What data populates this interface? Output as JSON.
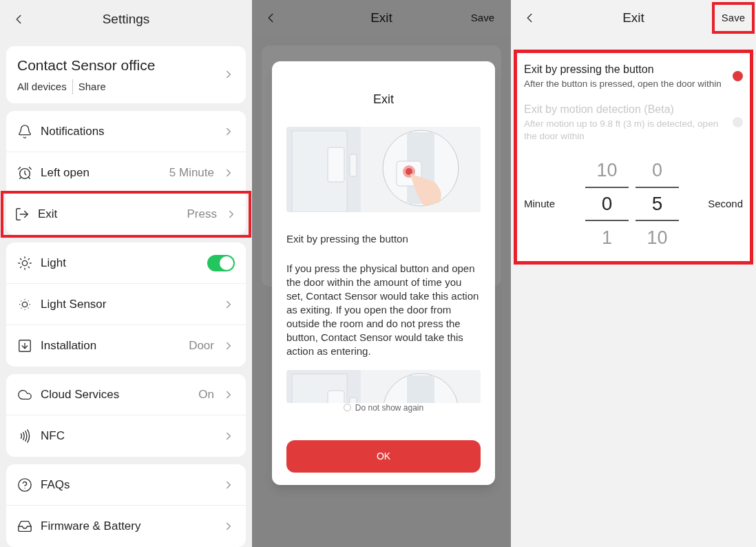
{
  "settings": {
    "title": "Settings",
    "device": {
      "name": "Contact Sensor office",
      "links": [
        "All devices",
        "Share"
      ]
    },
    "groups": [
      {
        "items": [
          {
            "kind": "link",
            "label": "Notifications",
            "highlighted": false
          },
          {
            "kind": "link",
            "label": "Left open",
            "value": "5 Minute",
            "highlighted": false
          },
          {
            "kind": "link",
            "label": "Exit",
            "value": "Press",
            "highlighted": true
          }
        ]
      },
      {
        "items": [
          {
            "kind": "toggle",
            "label": "Light",
            "on": true
          },
          {
            "kind": "link",
            "label": "Light Sensor",
            "highlighted": false
          },
          {
            "kind": "link",
            "label": "Installation",
            "value": "Door",
            "highlighted": false
          }
        ]
      },
      {
        "items": [
          {
            "kind": "link",
            "label": "Cloud Services",
            "value": "On",
            "highlighted": false
          },
          {
            "kind": "link",
            "label": "NFC",
            "highlighted": false
          }
        ]
      },
      {
        "items": [
          {
            "kind": "link",
            "label": "FAQs",
            "highlighted": false
          },
          {
            "kind": "link",
            "label": "Firmware & Battery",
            "highlighted": false
          }
        ]
      }
    ]
  },
  "exit_dialog_screen": {
    "header": {
      "title": "Exit",
      "action": "Save"
    },
    "dialog": {
      "title": "Exit",
      "subtitle": "Exit by pressing the button",
      "body": "If you press the physical button and open the door within the amount of time you set, Contact Sensor would take this action as exiting. If you open the door from outside the room and do not press the button, Contact Sensor would take this action as entering.",
      "checkbox": {
        "label": "Do not show again",
        "checked": false
      },
      "button": "OK"
    }
  },
  "exit_screen": {
    "header": {
      "title": "Exit",
      "action": "Save",
      "action_highlighted": true
    },
    "card_highlighted": true,
    "options": [
      {
        "title": "Exit by pressing the button",
        "description": "After the button is pressed, open the door within",
        "selected": true,
        "disabled": false
      },
      {
        "title": "Exit by motion detection (Beta)",
        "description": "After motion up to 9.8 ft (3 m) is detected, open the door within",
        "selected": false,
        "disabled": true
      }
    ],
    "picker": {
      "left_label": "Minute",
      "right_label": "Second",
      "columns": [
        {
          "above": "10",
          "value": "0",
          "below": "1"
        },
        {
          "above": "0",
          "value": "5",
          "below": "10"
        }
      ]
    }
  }
}
